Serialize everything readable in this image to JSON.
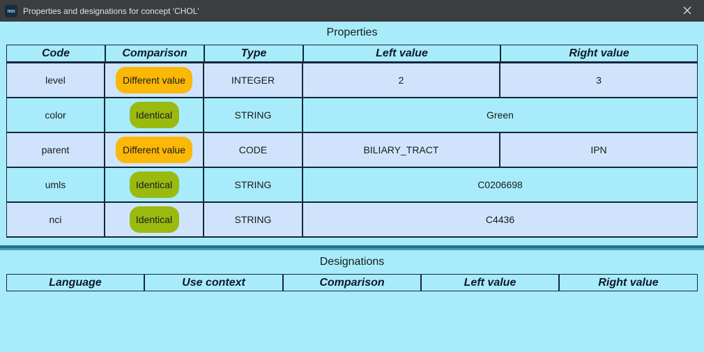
{
  "window": {
    "title": "Properties and designations for concept 'CHOL'",
    "icon": "app-logo-icon",
    "icon_text": "nmx"
  },
  "properties": {
    "section_title": "Properties",
    "columns": [
      "Code",
      "Comparison",
      "Type",
      "Left value",
      "Right value"
    ],
    "rows": [
      {
        "code": "level",
        "comparison": "Different value",
        "status": "different",
        "type": "INTEGER",
        "left": "2",
        "right": "3"
      },
      {
        "code": "color",
        "comparison": "Identical",
        "status": "identical",
        "type": "STRING",
        "value": "Green"
      },
      {
        "code": "parent",
        "comparison": "Different value",
        "status": "different",
        "type": "CODE",
        "left": "BILIARY_TRACT",
        "right": "IPN"
      },
      {
        "code": "umls",
        "comparison": "Identical",
        "status": "identical",
        "type": "STRING",
        "value": "C0206698"
      },
      {
        "code": "nci",
        "comparison": "Identical",
        "status": "identical",
        "type": "STRING",
        "value": "C4436"
      }
    ]
  },
  "designations": {
    "section_title": "Designations",
    "columns": [
      "Language",
      "Use context",
      "Comparison",
      "Left value",
      "Right value"
    ],
    "rows": []
  },
  "colors": {
    "background": "#a8ecfb",
    "row_alt": "#cfe4fc",
    "different_badge": "#fbb807",
    "identical_badge": "#9aba10",
    "titlebar": "#3b3d3f"
  }
}
